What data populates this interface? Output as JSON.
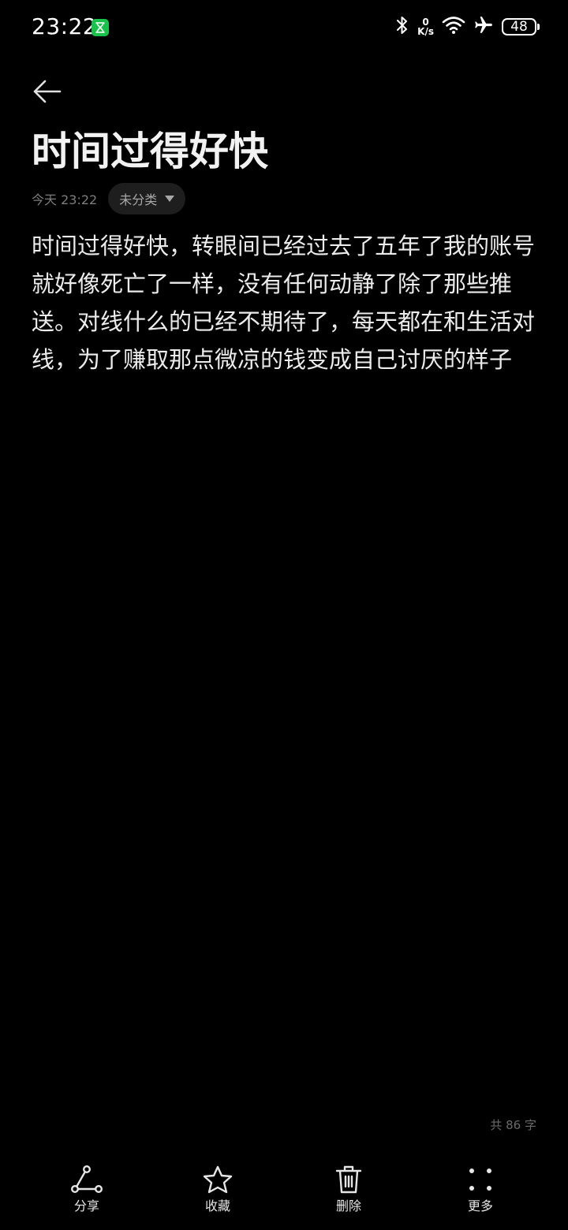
{
  "status_bar": {
    "time": "23:22",
    "net_speed_value": "0",
    "net_speed_unit": "K/s",
    "battery": "48"
  },
  "note": {
    "title": "时间过得好快",
    "date": "今天 23:22",
    "category": "未分类",
    "body": "时间过得好快，转眼间已经过去了五年了我的账号就好像死亡了一样，没有任何动静了除了那些推送。对线什么的已经不期待了，每天都在和生活对线，为了赚取那点微凉的钱变成自己讨厌的样子",
    "word_count": "共 86 字"
  },
  "toolbar": {
    "share_label": "分享",
    "favorite_label": "收藏",
    "delete_label": "删除",
    "more_label": "更多"
  },
  "icons": {
    "back": "arrow-left-icon",
    "share": "share-icon",
    "favorite": "star-icon",
    "delete": "trash-icon",
    "more": "dots-grid-icon"
  },
  "colors": {
    "background": "#000000",
    "text": "#ececec",
    "muted": "#7d7d7d",
    "chip_bg": "#1e1e1e",
    "badge_green": "#19c24a"
  }
}
